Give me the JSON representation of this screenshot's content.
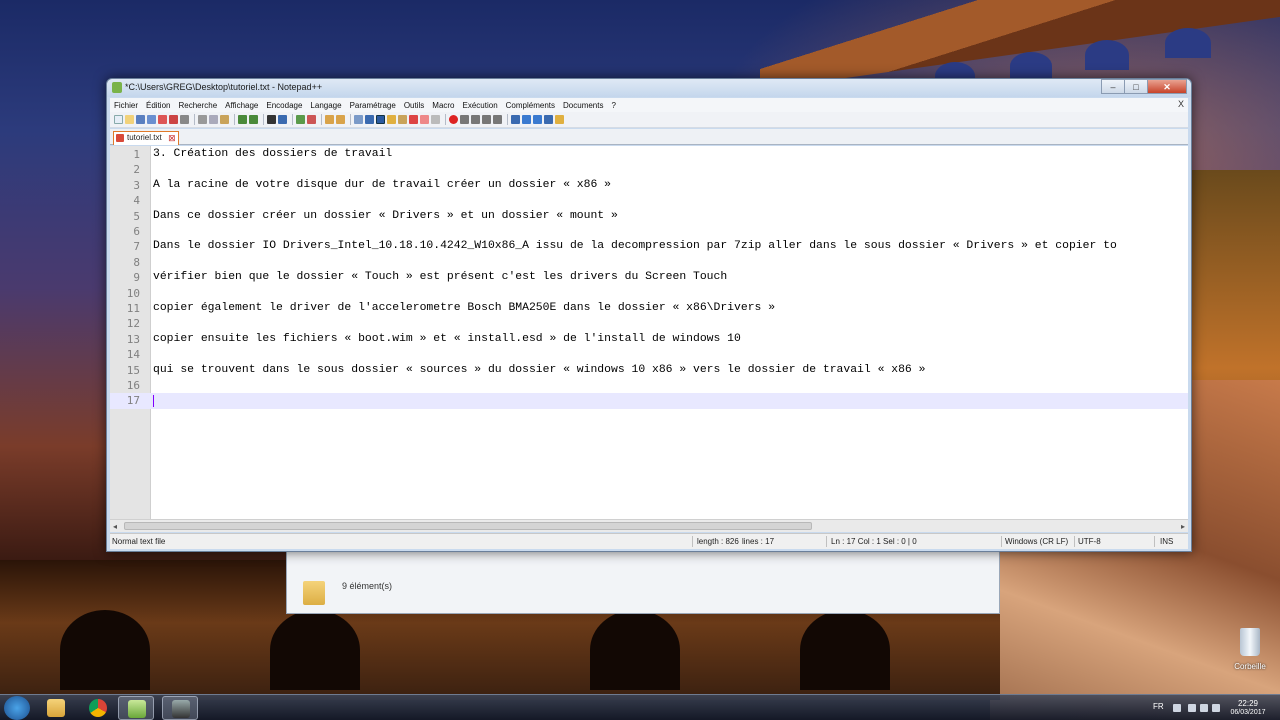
{
  "window": {
    "title": "*C:\\Users\\GREG\\Desktop\\tutoriel.txt - Notepad++",
    "controls": {
      "minimize": "–",
      "maximize": "□",
      "close": "✕"
    }
  },
  "menu": {
    "items": [
      "Fichier",
      "Édition",
      "Recherche",
      "Affichage",
      "Encodage",
      "Langage",
      "Paramétrage",
      "Outils",
      "Macro",
      "Exécution",
      "Compléments",
      "Documents",
      "?"
    ],
    "close": "X"
  },
  "tab": {
    "label": "tutoriel.txt",
    "close": "⊠"
  },
  "editor": {
    "lines": [
      {
        "n": "1",
        "text": "3. Création des dossiers de travail"
      },
      {
        "n": "2",
        "text": ""
      },
      {
        "n": "3",
        "text": "A la racine de votre disque dur de travail créer un dossier « x86 »"
      },
      {
        "n": "4",
        "text": ""
      },
      {
        "n": "5",
        "text": "Dans ce dossier créer un dossier « Drivers » et un dossier « mount »"
      },
      {
        "n": "6",
        "text": ""
      },
      {
        "n": "7",
        "text": "Dans le dossier IO Drivers_Intel_10.18.10.4242_W10x86_A issu de la decompression par 7zip aller dans le sous dossier « Drivers » et copier to"
      },
      {
        "n": "8",
        "text": ""
      },
      {
        "n": "9",
        "text": "vérifier bien que le dossier « Touch » est présent c'est les drivers du Screen Touch"
      },
      {
        "n": "10",
        "text": ""
      },
      {
        "n": "11",
        "text": "copier également le driver de l'accelerometre Bosch BMA250E dans le dossier « x86\\Drivers »"
      },
      {
        "n": "12",
        "text": ""
      },
      {
        "n": "13",
        "text": "copier ensuite les fichiers « boot.wim » et « install.esd » de l'install de windows 10"
      },
      {
        "n": "14",
        "text": ""
      },
      {
        "n": "15",
        "text": "qui se trouvent dans le sous dossier « sources » du dossier « windows 10 x86 » vers le dossier de travail « x86 »"
      },
      {
        "n": "16",
        "text": ""
      },
      {
        "n": "17",
        "text": ""
      }
    ],
    "current_line": "17"
  },
  "status": {
    "file_type": "Normal text file",
    "length": "length : 826",
    "lines": "lines : 17",
    "position": "Ln : 17    Col : 1    Sel : 0 | 0",
    "eol": "Windows (CR LF)",
    "encoding": "UTF-8",
    "mode": "INS"
  },
  "explorer": {
    "item_count": "9 élément(s)"
  },
  "desktop": {
    "recycle_bin": "Corbeille"
  },
  "taskbar": {
    "language": "FR",
    "time": "22:29",
    "date": "06/03/2017"
  },
  "colors": {
    "current_line": "#e8e8ff",
    "caret": "#8000ff",
    "line_numbers": "#808080"
  }
}
